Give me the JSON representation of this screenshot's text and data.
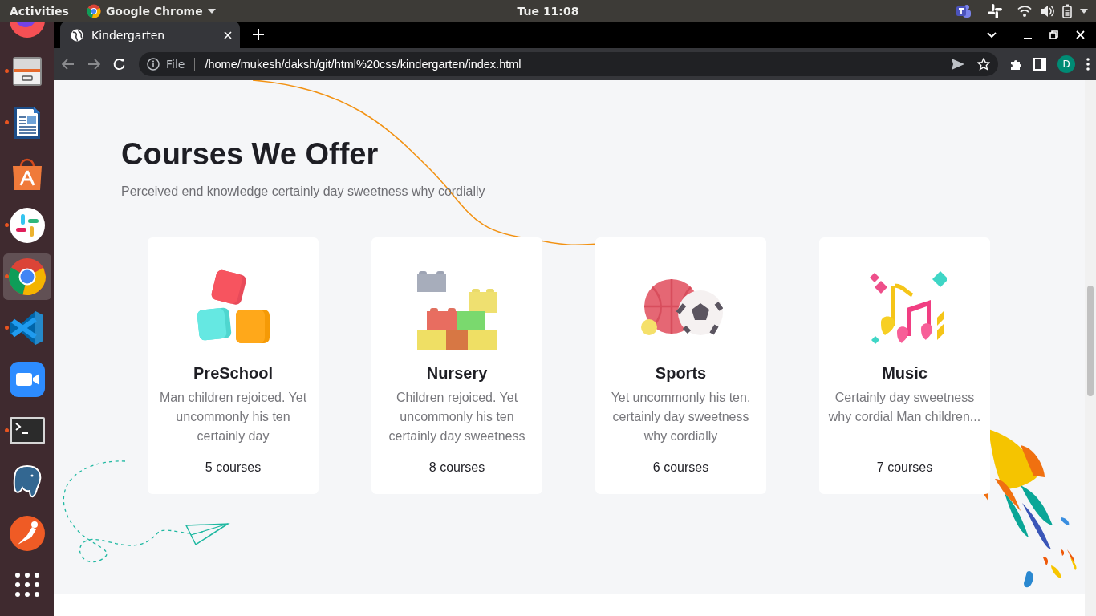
{
  "top_bar": {
    "activities": "Activities",
    "app_menu": "Google Chrome",
    "clock": "Tue 11:08"
  },
  "dock": [
    {
      "kind": "firefox",
      "selected": false
    },
    {
      "kind": "files",
      "running": true,
      "selected": false
    },
    {
      "kind": "writer",
      "running": true,
      "selected": false
    },
    {
      "kind": "software",
      "running": false,
      "selected": false
    },
    {
      "kind": "slack",
      "running": true,
      "selected": false
    },
    {
      "kind": "chrome",
      "running": true,
      "selected": true
    },
    {
      "kind": "vscode",
      "running": true,
      "selected": false
    },
    {
      "kind": "zoom",
      "running": false,
      "selected": false
    },
    {
      "kind": "terminal",
      "running": true,
      "selected": false
    },
    {
      "kind": "postgres",
      "running": false,
      "selected": false
    },
    {
      "kind": "postman",
      "running": false,
      "selected": false
    },
    {
      "kind": "apps",
      "running": false,
      "selected": false
    }
  ],
  "browser": {
    "tabs": [
      {
        "title": "Kindergarten",
        "selected": true
      }
    ],
    "address": {
      "scheme": "File",
      "url": "/home/mukesh/daksh/git/html%20css/kindergarten/index.html"
    },
    "profile": "D"
  },
  "page": {
    "title": "Courses We Offer",
    "subtitle": "Perceived end knowledge certainly day sweetness why cordially",
    "cards": [
      {
        "kind": "blocks",
        "title": "PreSchool",
        "description": "Man children rejoiced. Yet uncommonly his ten certainly day",
        "count": "5 courses"
      },
      {
        "kind": "bricks",
        "title": "Nursery",
        "description": "Children rejoiced. Yet uncommonly his ten certainly day sweetness",
        "count": "8 courses"
      },
      {
        "kind": "balls",
        "title": "Sports",
        "description": "Yet uncommonly his ten. certainly day sweetness why cordially",
        "count": "6 courses"
      },
      {
        "kind": "notes",
        "title": "Music",
        "description": "Certainly day sweetness why cordial Man children...",
        "count": "7 courses"
      }
    ]
  }
}
